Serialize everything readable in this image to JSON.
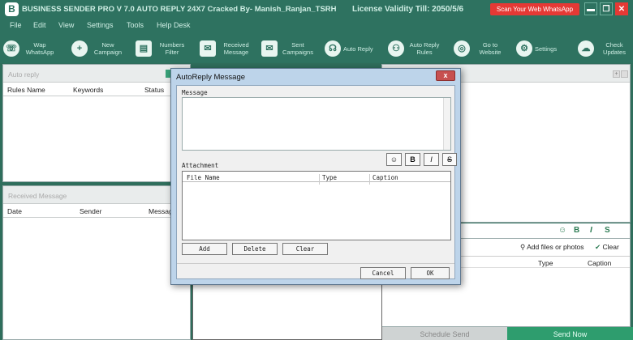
{
  "app": {
    "logo_letter": "B",
    "title": "BUSINESS SENDER PRO V 7.0 AUTO REPLY 24X7 Cracked By- Manish_Ranjan_TSRH",
    "license": "License Validity Till:   2050/5/6",
    "scan_button": "Scan Your Web WhatsApp",
    "controls": [
      "▬",
      "❐",
      "✕"
    ]
  },
  "menu": [
    "File",
    "Edit",
    "View",
    "Settings",
    "Tools",
    "Help Desk"
  ],
  "toolbar": [
    {
      "icon": "whatsapp-icon",
      "glyph": "☏",
      "label": "Wap WhatsApp"
    },
    {
      "icon": "plus-icon",
      "glyph": "+",
      "label": "New Campaign"
    },
    {
      "icon": "filter-icon",
      "glyph": "▤",
      "label": "Numbers Filter"
    },
    {
      "icon": "inbox-icon",
      "glyph": "✉",
      "label": "Received Message"
    },
    {
      "icon": "sent-icon",
      "glyph": "✉",
      "label": "Sent Campaigns"
    },
    {
      "icon": "headset-icon",
      "glyph": "☊",
      "label": "Auto Reply"
    },
    {
      "icon": "rules-icon",
      "glyph": "⚇",
      "label": "Auto Reply Rules"
    },
    {
      "icon": "globe-icon",
      "glyph": "◎",
      "label": "Go to Website"
    },
    {
      "icon": "gear-icon",
      "glyph": "⚙",
      "label": "Settings"
    },
    {
      "icon": "cloud-icon",
      "glyph": "☁",
      "label": "Check Updates"
    }
  ],
  "auto_reply_panel": {
    "title": "Auto reply",
    "columns": [
      "Rules Name",
      "Keywords",
      "Status"
    ]
  },
  "received_panel": {
    "title": "Received Message",
    "columns": [
      "Date",
      "Sender",
      "Message"
    ]
  },
  "compose": {
    "format": [
      "☺",
      "B",
      "I",
      "S"
    ],
    "add_files": "Add files or photos",
    "clear": "Clear",
    "attach_cols": [
      "Type",
      "Caption"
    ],
    "schedule": "Schedule Send",
    "send": "Send Now"
  },
  "dialog": {
    "title": "AutoReply Message",
    "close": "x",
    "message_label": "Message",
    "attachment_label": "Attachment",
    "format": [
      "☺",
      "B",
      "I",
      "S"
    ],
    "columns": [
      "File Name",
      "Type",
      "Caption"
    ],
    "buttons": [
      "Add",
      "Delete",
      "Clear"
    ],
    "cancel": "Cancel",
    "ok": "OK"
  }
}
